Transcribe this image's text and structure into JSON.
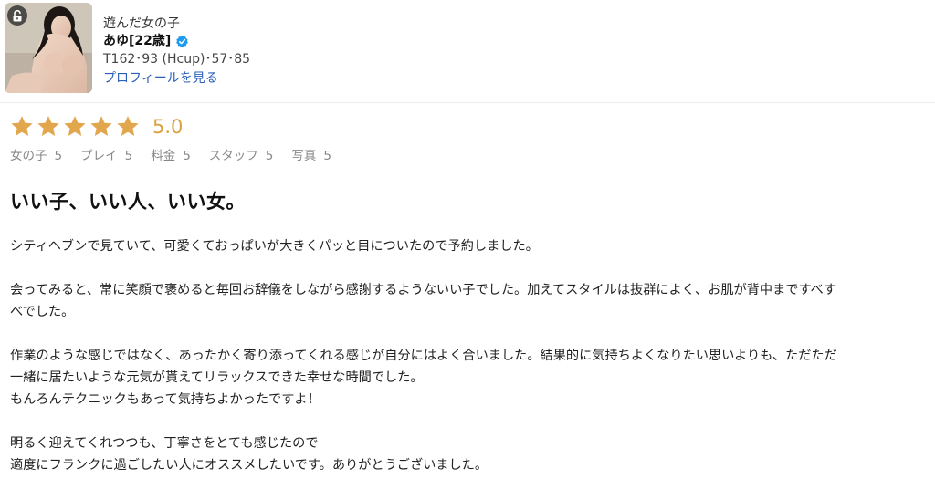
{
  "cast": {
    "shop_name": "遊んだ女の子",
    "name": "あゆ[22歳]",
    "spec": "T162･93 (Hcup)･57･85",
    "profile_link": "プロフィールを見る"
  },
  "rating": {
    "stars": 5,
    "score": "5.0",
    "star_color": "#e2a64d",
    "score_color": "#d9a23e",
    "sub": [
      {
        "label": "女の子",
        "value": "5"
      },
      {
        "label": "プレイ",
        "value": "5"
      },
      {
        "label": "料金",
        "value": "5"
      },
      {
        "label": "スタッフ",
        "value": "5"
      },
      {
        "label": "写真",
        "value": "5"
      }
    ]
  },
  "review": {
    "title": "いい子、いい人、いい女。",
    "lines": [
      "シティヘブンで見ていて、可愛くておっぱいが大きくパッと目についたので予約しました。",
      "",
      "会ってみると、常に笑顔で褒めると毎回お辞儀をしながら感謝するようないい子でした。加えてスタイルは抜群によく、お肌が背中まですべす",
      "べでした。",
      "",
      "作業のような感じではなく、あったかく寄り添ってくれる感じが自分にはよく合いました。結果的に気持ちよくなりたい思いよりも、ただただ",
      "一緒に居たいような元気が貰えてリラックスできた幸せな時間でした。",
      "もんろんテクニックもあって気持ちよかったですよ！",
      "",
      "明るく迎えてくれつつも、丁寧さをとても感じたので",
      "適度にフランクに過ごしたい人にオススメしたいです。ありがとうございました。"
    ]
  },
  "colors": {
    "link": "#2b5fb8",
    "verified": "#1d9bf0"
  }
}
